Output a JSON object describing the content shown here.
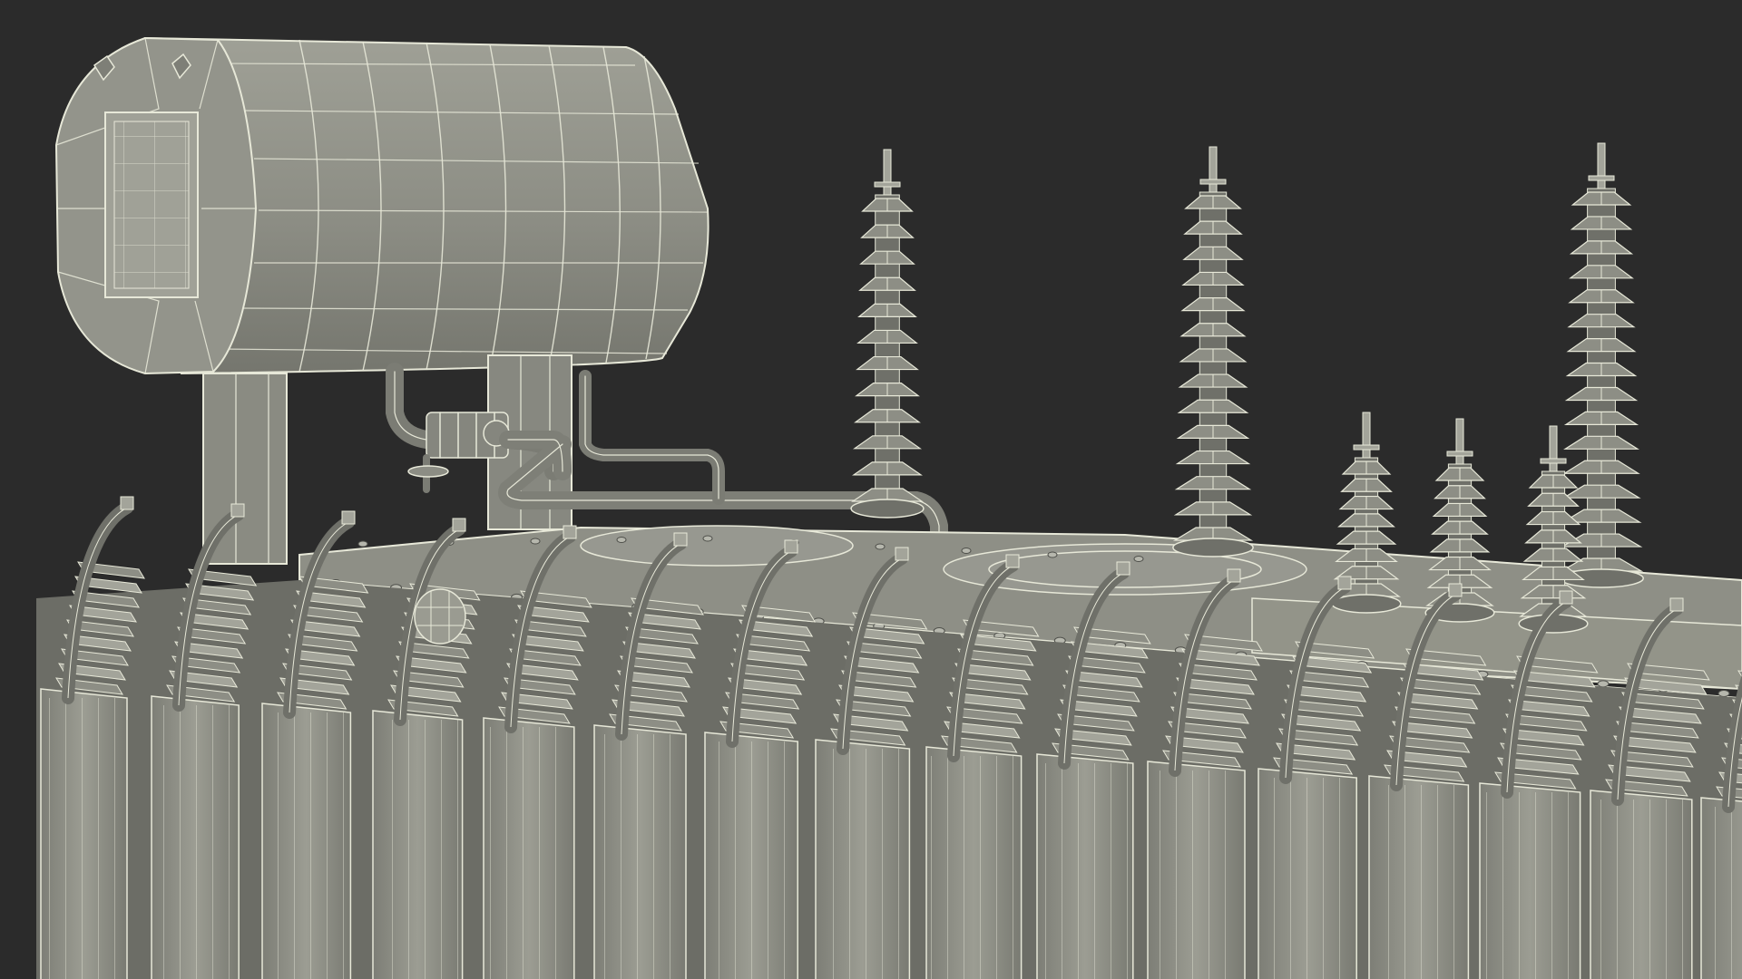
{
  "scene": {
    "subject": "power-transformer",
    "render_style": "wireframe-over-clay",
    "colors": {
      "background": "#2b2b2b",
      "surface": "#8d8e85",
      "surface_light": "#a3a49a",
      "surface_dark": "#6f7069",
      "shadow": "#4f504b",
      "wire": "#e7e8d8",
      "edge": "#3b3c38"
    },
    "counts": {
      "high_voltage_bushings": 3,
      "low_voltage_bushings": 3,
      "radiator_fins_visible": 16
    }
  }
}
